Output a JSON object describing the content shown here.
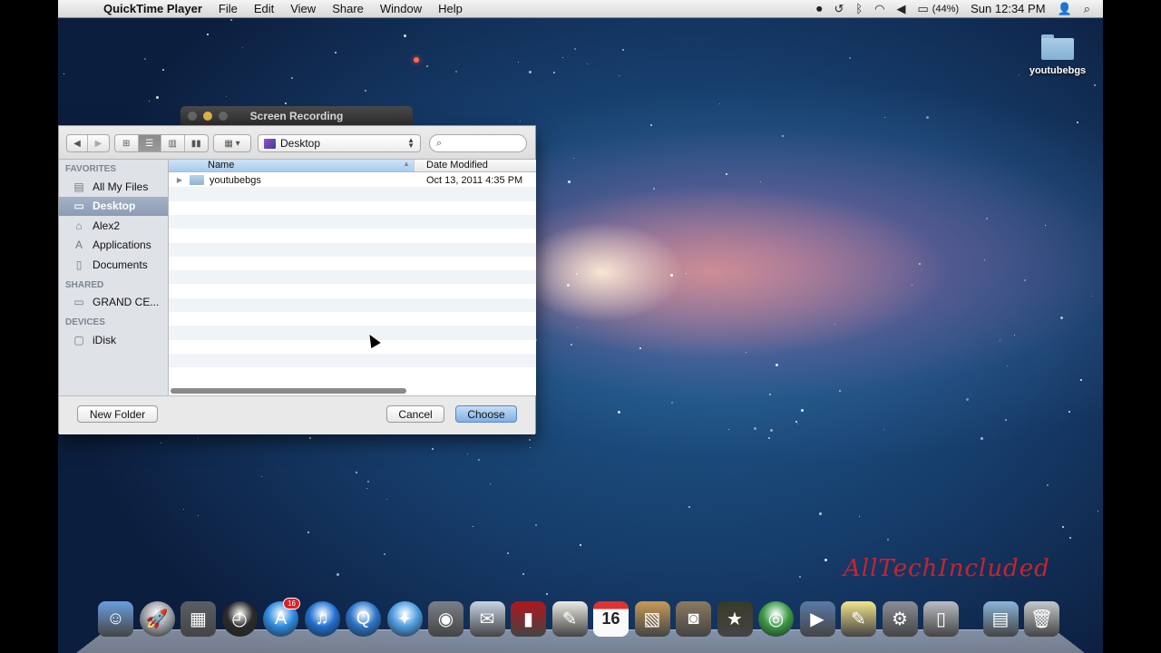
{
  "menubar": {
    "apple_icon": "apple-logo",
    "app_name": "QuickTime Player",
    "menus": [
      "File",
      "Edit",
      "View",
      "Share",
      "Window",
      "Help"
    ],
    "status_icons": [
      "screen-recording-icon",
      "time-machine-icon",
      "bluetooth-icon",
      "wifi-icon",
      "volume-icon",
      "battery-icon"
    ],
    "battery_percent": "(44%)",
    "clock": "Sun 12:34 PM",
    "user_icon": "user-icon",
    "spotlight_icon": "search-icon"
  },
  "background_window": {
    "title": "Screen Recording"
  },
  "dialog": {
    "toolbar": {
      "back_label": "◀",
      "forward_label": "▶",
      "view_modes": [
        "icon",
        "list",
        "column",
        "cover-flow"
      ],
      "active_view": "list",
      "arrange_label": "▦ ▾",
      "location": "Desktop",
      "search_placeholder": ""
    },
    "sidebar": {
      "sections": [
        {
          "heading": "FAVORITES",
          "items": [
            {
              "label": "All My Files",
              "icon": "all-files-icon",
              "selected": false
            },
            {
              "label": "Desktop",
              "icon": "desktop-icon",
              "selected": true
            },
            {
              "label": "Alex2",
              "icon": "home-icon",
              "selected": false
            },
            {
              "label": "Applications",
              "icon": "applications-icon",
              "selected": false
            },
            {
              "label": "Documents",
              "icon": "documents-icon",
              "selected": false
            }
          ]
        },
        {
          "heading": "SHARED",
          "items": [
            {
              "label": "GRAND CE...",
              "icon": "network-drive-icon",
              "selected": false
            }
          ]
        },
        {
          "heading": "DEVICES",
          "items": [
            {
              "label": "iDisk",
              "icon": "idisk-icon",
              "selected": false
            }
          ]
        }
      ]
    },
    "list": {
      "columns": [
        "Name",
        "Date Modified"
      ],
      "sort_column": "Name",
      "rows": [
        {
          "name": "youtubebgs",
          "date": "Oct 13, 2011 4:35 PM",
          "type": "folder"
        }
      ]
    },
    "buttons": {
      "new_folder": "New Folder",
      "cancel": "Cancel",
      "choose": "Choose"
    }
  },
  "desktop": {
    "icons": [
      {
        "label": "youtubebgs",
        "type": "folder"
      }
    ],
    "watermark": "AllTechIncluded"
  },
  "dock": {
    "items": [
      {
        "name": "Finder",
        "icon": "finder-icon",
        "color": "#6a9ee0"
      },
      {
        "name": "Launchpad",
        "icon": "launchpad-icon",
        "color": "#9a9ea6"
      },
      {
        "name": "Mission Control",
        "icon": "mission-control-icon",
        "color": "#5a5f66"
      },
      {
        "name": "Dashboard",
        "icon": "dashboard-icon",
        "color": "#2a2a2a"
      },
      {
        "name": "App Store",
        "icon": "app-store-icon",
        "color": "#2e8be0",
        "badge": "16"
      },
      {
        "name": "iTunes",
        "icon": "itunes-icon",
        "color": "#1f6fd0"
      },
      {
        "name": "QuickTime Player",
        "icon": "quicktime-icon",
        "color": "#2a74c8"
      },
      {
        "name": "Safari",
        "icon": "safari-icon",
        "color": "#4a9be0"
      },
      {
        "name": "FaceTime",
        "icon": "facetime-icon",
        "color": "#7a7f88"
      },
      {
        "name": "Mail",
        "icon": "mail-icon",
        "color": "#c8d4e4"
      },
      {
        "name": "Photo Booth",
        "icon": "photo-booth-icon",
        "color": "#b0161c"
      },
      {
        "name": "TextEdit",
        "icon": "textedit-icon",
        "color": "#ecebe4"
      },
      {
        "name": "iCal",
        "icon": "calendar-icon",
        "color": "#f4f4f4",
        "text": "16"
      },
      {
        "name": "Preview",
        "icon": "preview-icon",
        "color": "#c89a58"
      },
      {
        "name": "iPhoto",
        "icon": "iphoto-icon",
        "color": "#8a7a60"
      },
      {
        "name": "iMovie",
        "icon": "imovie-icon",
        "color": "#3a3a2a"
      },
      {
        "name": "Google Chrome",
        "icon": "chrome-icon",
        "color": "#3a9a46"
      },
      {
        "name": "Movie Maker",
        "icon": "movie-icon",
        "color": "#5a7aa8"
      },
      {
        "name": "Stickies",
        "icon": "stickies-icon",
        "color": "#f4e48a"
      },
      {
        "name": "System Preferences",
        "icon": "system-preferences-icon",
        "color": "#8a8e96"
      },
      {
        "name": "Trash (Application)",
        "icon": "trash-can-icon",
        "color": "#b8bcc2"
      },
      {
        "name": "Movies",
        "icon": "movies-folder-icon",
        "color": "#8ab4d8"
      },
      {
        "name": "Trash",
        "icon": "trash-icon",
        "color": "#c4c8cc"
      }
    ]
  }
}
